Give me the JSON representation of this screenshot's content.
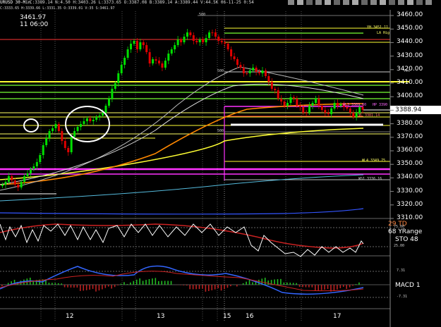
{
  "header": {
    "symbol_info": "URUSD  30-Min",
    "ohlc": "C:3389.14  N:4.50  H:3403.26  L:3373.65  O:3387.08  B:3389.14  A:3389.44  V:44.5K  06-11-25  0:54",
    "sub_info": "C:3333.65  H:3339.66  L:3331.35  O:3339.01  V:35  S:3461.97",
    "crosshair_value": "3461.97",
    "crosshair_time": "11 06:00",
    "toolbar_icons": [
      "win-icon-1",
      "win-icon-2",
      "win-icon-3",
      "win-icon-4",
      "win-icon-5",
      "win-icon-6",
      "win-icon-7",
      "win-icon-8",
      "win-icon-9",
      "win-icon-10",
      "win-icon-11",
      "win-icon-12",
      "win-icon-13",
      "win-icon-14",
      "win-icon-15",
      "win-icon-16"
    ]
  },
  "price_axis": {
    "ticks": [
      "3460.00",
      "3450.00",
      "3440.00",
      "3430.00",
      "3420.00",
      "3410.00",
      "3400.00",
      "3390.00",
      "3380.00",
      "3370.00",
      "3360.00",
      "3350.00",
      "3340.00",
      "3330.00",
      "3320.00",
      "3310.00"
    ],
    "current_price": "3388.94"
  },
  "time_axis": {
    "labels": [
      "12",
      "13",
      "15",
      "16",
      "17"
    ]
  },
  "annotations": {
    "yh": "YH 3451.11",
    "la": "LA Hig",
    "yes": "Yes",
    "wl3": "WL3 3389.60",
    "hp": "HP 3390",
    "vl": "VL 3381.14",
    "wl4": "WL4 3349.75",
    "ws1": "WS1 3336.16",
    "b500": "500",
    "b50": "500",
    "b08": "500"
  },
  "stoch": {
    "td": "29 TD",
    "yrange": "68 YRange",
    "label": "STO  48",
    "ticks": [
      "75.00",
      "25.00"
    ]
  },
  "macd": {
    "label": "MACD 1",
    "ticks": [
      "7.31",
      "-7.31"
    ]
  },
  "colors": {
    "bull": "#00e000",
    "bear": "#e00000",
    "yellow": "#ffff33",
    "magenta": "#ff33ff",
    "green_line": "#66ff33",
    "orange": "#ff8800",
    "white": "#ffffff",
    "blue": "#3366ff"
  }
}
